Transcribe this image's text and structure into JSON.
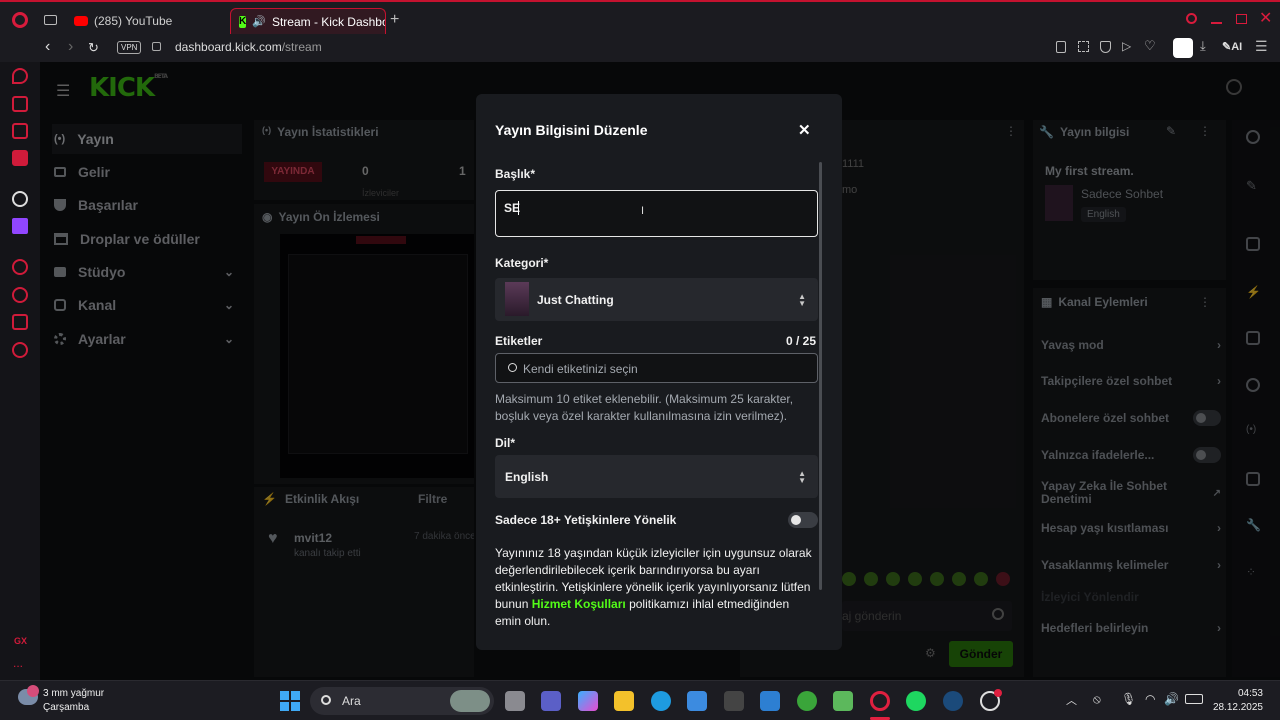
{
  "browser": {
    "tabs": [
      {
        "label": "(285) YouTube",
        "active": false
      },
      {
        "label": "Stream - Kick Dashboa",
        "active": true
      }
    ],
    "url_domain": "dashboard.kick.com",
    "url_path": "/stream",
    "vpn_label": "VPN",
    "ai_label": "AI"
  },
  "opera_sidebar": {
    "gx_label": "GX",
    "more": "..."
  },
  "brand": {
    "logo": "KICK",
    "beta": "BETA"
  },
  "nav": {
    "items": [
      {
        "label": "Yayın",
        "icon": "broadcast-icon"
      },
      {
        "label": "Gelir",
        "icon": "wallet-icon"
      },
      {
        "label": "Başarılar",
        "icon": "trophy-icon"
      },
      {
        "label": "Droplar ve ödüller",
        "icon": "gift-icon"
      },
      {
        "label": "Stüdyo",
        "icon": "camera-icon"
      },
      {
        "label": "Kanal",
        "icon": "channel-icon"
      },
      {
        "label": "Ayarlar",
        "icon": "gear-icon"
      }
    ]
  },
  "stats_panel": {
    "title": "Yayın İstatistikleri",
    "status": "YAYINDA",
    "values": [
      "0",
      "1"
    ],
    "sub": "İzleyiciler"
  },
  "preview_panel": {
    "title": "Yayın Ön İzlemesi"
  },
  "events_panel": {
    "title": "Etkinlik Akışı",
    "filter": "Filtre",
    "event_user": "mvit12",
    "event_desc": "kanalı takip etti",
    "event_time": "7 dakika önce"
  },
  "chat_panel": {
    "frag1": "1111",
    "frag2": "mo",
    "input_placeholder": "aj gönderin",
    "send_label": "Gönder"
  },
  "stream_info": {
    "title": "Yayın bilgisi",
    "stream_title": "My first stream.",
    "category": "Sadece Sohbet",
    "language": "English"
  },
  "channel_actions": {
    "title": "Kanal Eylemleri",
    "items": [
      {
        "label": "Yavaş mod",
        "type": "arrow"
      },
      {
        "label": "Takipçilere özel sohbet",
        "type": "arrow"
      },
      {
        "label": "Abonelere özel sohbet",
        "type": "toggle"
      },
      {
        "label": "Yalnızca ifadelerle...",
        "type": "toggle"
      },
      {
        "label": "Yapay Zeka İle Sohbet Denetimi",
        "type": "link"
      },
      {
        "label": "Hesap yaşı kısıtlaması",
        "type": "arrow"
      },
      {
        "label": "Yasaklanmış kelimeler",
        "type": "arrow"
      },
      {
        "label": "İzleyici Yönlendir",
        "type": "disabled"
      },
      {
        "label": "Hedefleri belirleyin",
        "type": "arrow"
      }
    ]
  },
  "modal": {
    "title": "Yayın Bilgisini Düzenle",
    "title_label": "Başlık*",
    "title_value": "SE",
    "category_label": "Kategori*",
    "category_value": "Just Chatting",
    "tags_label": "Etiketler",
    "tags_count": "0 / 25",
    "tags_placeholder": "Kendi etiketinizi seçin",
    "tags_help": "Maksimum 10 etiket eklenebilir. (Maksimum 25 karakter, boşluk veya özel karakter kullanılmasına izin verilmez).",
    "language_label": "Dil*",
    "language_value": "English",
    "adult_label": "Sadece 18+ Yetişkinlere Yönelik",
    "adult_enabled": false,
    "warning_before": "Yayınınız 18 yaşından küçük izleyiciler için uygunsuz olarak değerlendirilebilecek içerik barındırıyorsa bu ayarı etkinleştirin. Yetişkinlere yönelik içerik yayınlıyorsanız lütfen bunun ",
    "warning_link": "Hizmet Koşulları",
    "warning_after": " politikamızı ihlal etmediğinden emin olun."
  },
  "taskbar": {
    "weather_line1": "3 mm yağmur",
    "weather_line2": "Çarşamba",
    "search_label": "Ara",
    "time": "04:53",
    "date": "28.12.2025"
  },
  "colors": {
    "kick_green": "#53fc18",
    "opera_red": "#c4122f",
    "live_red": "#a3132a"
  }
}
